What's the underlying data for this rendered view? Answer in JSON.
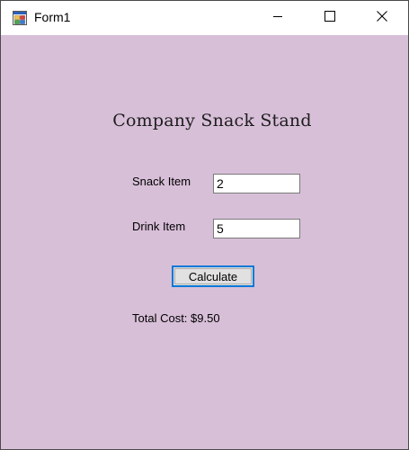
{
  "window": {
    "title": "Form1",
    "icon": "winforms-app-icon",
    "controls": [
      "minimize-icon",
      "maximize-icon",
      "close-icon"
    ],
    "background": "#d8bfd8"
  },
  "form": {
    "heading": "Company Snack Stand",
    "snack_label": "Snack Item",
    "snack_value": "2",
    "drink_label": "Drink Item",
    "drink_value": "5",
    "calculate_label": "Calculate",
    "total_text": "Total Cost: $9.50"
  },
  "colors": {
    "accent": "#0078d7"
  }
}
